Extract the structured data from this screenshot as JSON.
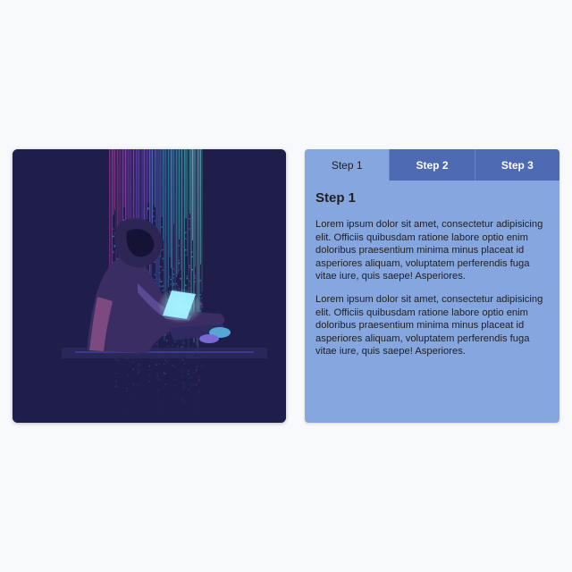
{
  "image": {
    "description_icon": "hacker-illustration"
  },
  "tabs": [
    {
      "label": "Step 1",
      "active": true
    },
    {
      "label": "Step 2",
      "active": false
    },
    {
      "label": "Step 3",
      "active": false
    }
  ],
  "content": {
    "heading": "Step 1",
    "paragraphs": [
      "Lorem ipsum dolor sit amet, consectetur adipisicing elit. Officiis quibusdam ratione labore optio enim doloribus praesentium minima minus placeat id asperiores aliquam, voluptatem perferendis fuga vitae iure, quis saepe! Asperiores.",
      "Lorem ipsum dolor sit amet, consectetur adipisicing elit. Officiis quibusdam ratione labore optio enim doloribus praesentium minima minus placeat id asperiores aliquam, voluptatem perferendis fuga vitae iure, quis saepe! Asperiores."
    ]
  },
  "colors": {
    "tab_inactive": "#4e6ab3",
    "tab_active": "#86a6e0",
    "panel": "#86a6e0",
    "image_bg": "#1f1d4a"
  }
}
